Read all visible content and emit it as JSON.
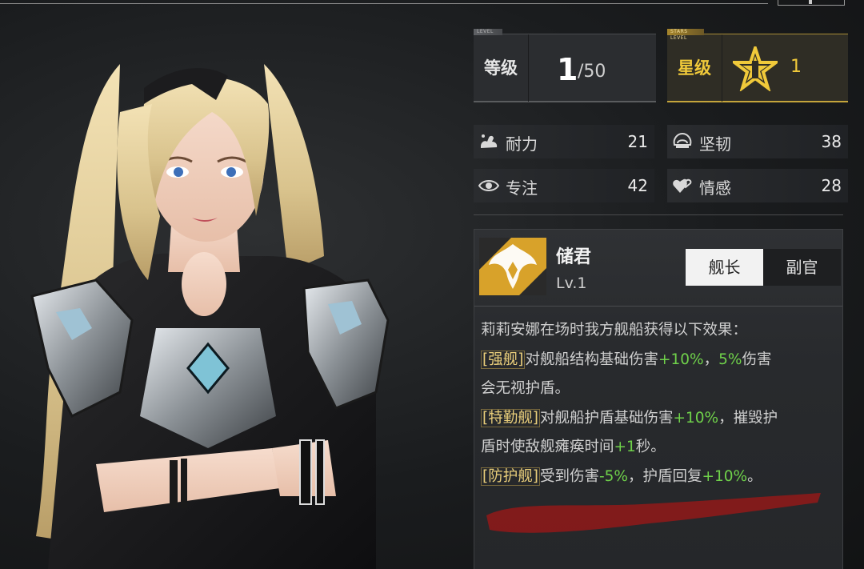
{
  "level_card": {
    "tag": "LEVEL",
    "label": "等级",
    "value": "1",
    "max": "/50"
  },
  "star_card": {
    "tag": "STARS LEVEL",
    "label": "星级",
    "value": "1"
  },
  "attributes": [
    {
      "name": "耐力",
      "value": "21",
      "icon": "flexed-arm-icon"
    },
    {
      "name": "坚韧",
      "value": "38",
      "icon": "brain-shield-icon"
    },
    {
      "name": "专注",
      "value": "42",
      "icon": "eye-icon"
    },
    {
      "name": "情感",
      "value": "28",
      "icon": "hearts-icon"
    }
  ],
  "skill": {
    "name": "储君",
    "level": "Lv.1",
    "icon": "winged-crest-icon",
    "tabs": [
      "舰长",
      "副官"
    ],
    "active_tab": "舰长",
    "intro": "莉莉安娜在场时我方舰船获得以下效果：",
    "effects": {
      "e1_kw": "[强舰]",
      "e1_t1": "对舰船结构基础伤害",
      "e1_v1": "+10%",
      "e1_t2": "，",
      "e1_v2": "5%",
      "e1_t3": "伤害",
      "e1_t4": "会无视护盾。",
      "e2_kw": "[特勤舰]",
      "e2_t1": "对舰船护盾基础伤害",
      "e2_v1": "+10%",
      "e2_t2": "，摧毁护",
      "e2_t3": "盾时使敌舰瘫痪时间",
      "e2_v2": "+1",
      "e2_t4": "秒。",
      "e3_kw": "[防护舰]",
      "e3_t1": "受到伤害",
      "e3_v1": "-5%",
      "e3_t2": "，护盾回复",
      "e3_v2": "+10%",
      "e3_t3": "。"
    }
  },
  "colors": {
    "gold": "#f0c93a",
    "positive": "#6fd14a",
    "keyword": "#e8cd7a",
    "redaction": "#8c1a1a"
  }
}
